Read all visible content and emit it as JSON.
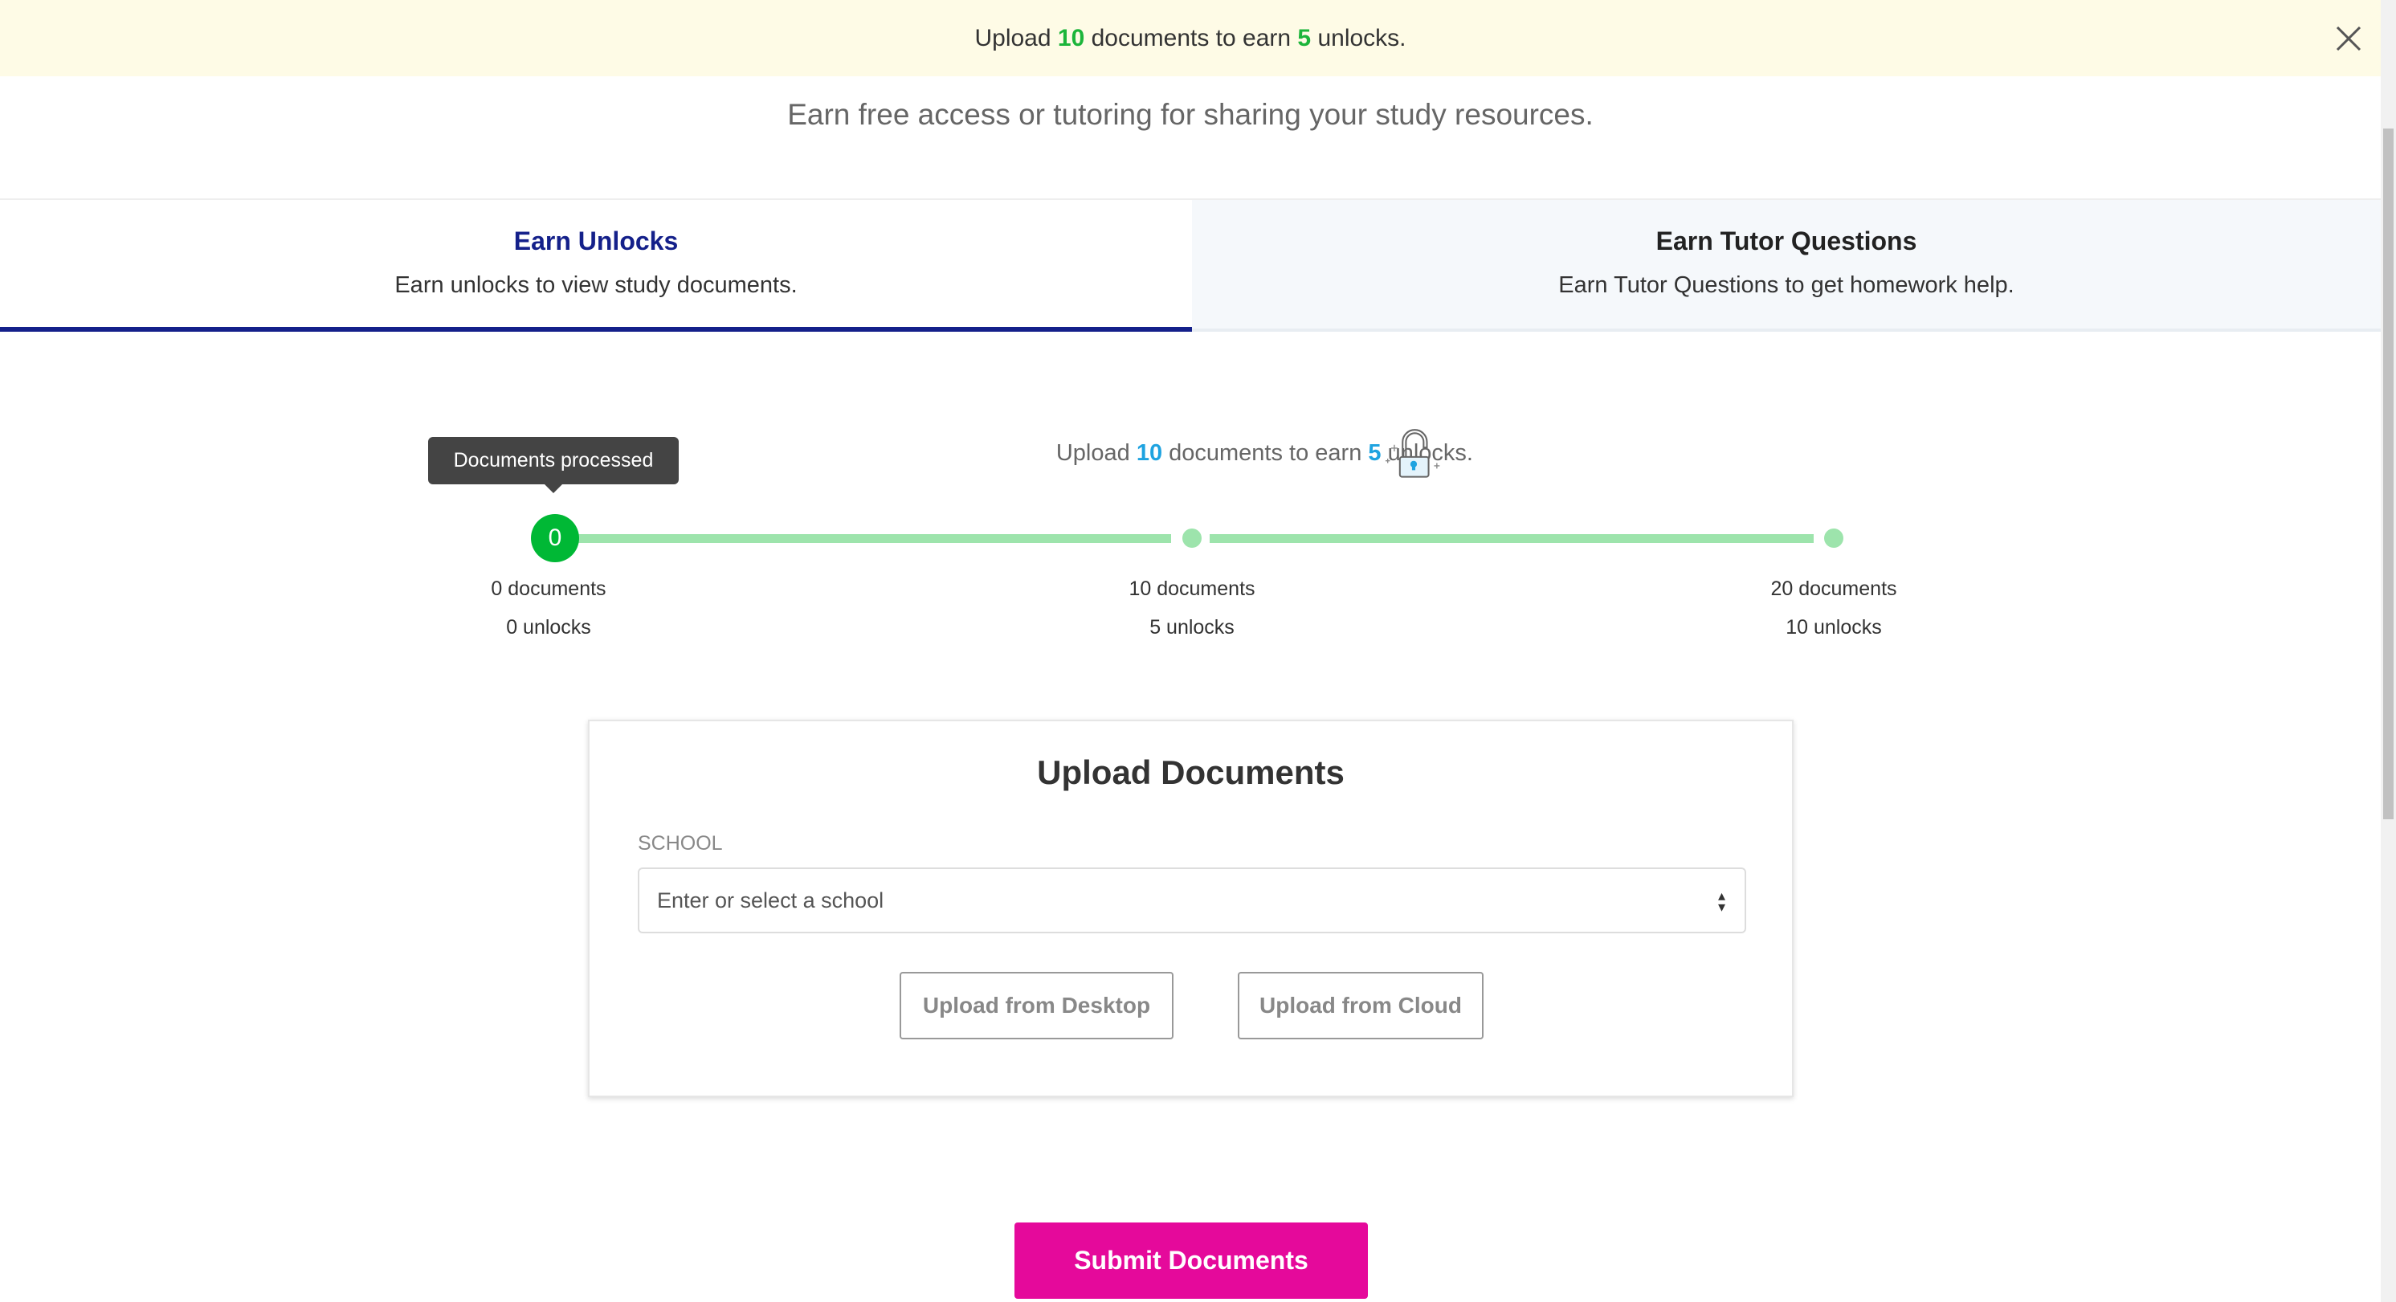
{
  "banner": {
    "pre": "Upload ",
    "docs": "10",
    "mid": " documents to earn ",
    "unlocks": "5",
    "post": " unlocks."
  },
  "subtitle": "Earn free access or tutoring for sharing your study resources.",
  "tabs": [
    {
      "title": "Earn Unlocks",
      "desc": "Earn unlocks to view study documents.",
      "active": true
    },
    {
      "title": "Earn Tutor Questions",
      "desc": "Earn Tutor Questions to get homework help.",
      "active": false
    }
  ],
  "progress": {
    "tooltip": "Documents processed",
    "current": "0",
    "current_value": 0,
    "headline": {
      "pre": "Upload ",
      "docs": "10",
      "mid": " documents to earn ",
      "unlocks": "5",
      "post": " unlocks."
    },
    "milestones": [
      {
        "docs": "0 documents",
        "unlocks": "0 unlocks"
      },
      {
        "docs": "10 documents",
        "unlocks": "5 unlocks"
      },
      {
        "docs": "20 documents",
        "unlocks": "10 unlocks"
      }
    ],
    "icon": "unlocked-padlock-icon"
  },
  "upload": {
    "title": "Upload Documents",
    "school_label": "SCHOOL",
    "school_placeholder": "Enter or select a school",
    "desktop_button": "Upload from Desktop",
    "cloud_button": "Upload from Cloud"
  },
  "submit": "Submit Documents",
  "colors": {
    "accent_green": "#00b835",
    "brand_blue": "#14208a",
    "submit": "#e5099b",
    "highlight_blue": "#1fa3e0"
  }
}
